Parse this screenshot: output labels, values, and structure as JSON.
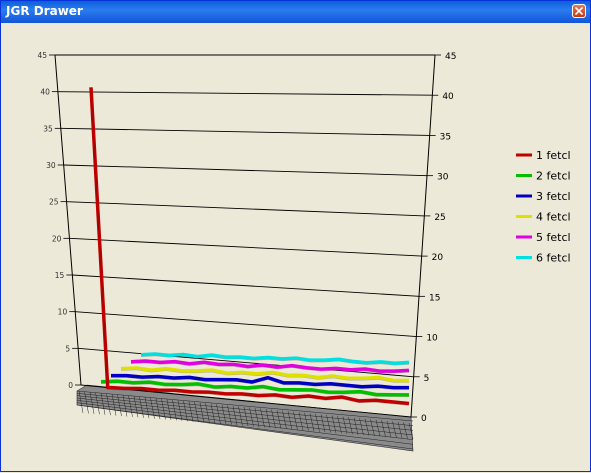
{
  "window": {
    "title": "JGR Drawer"
  },
  "chart_data": {
    "type": "line",
    "projection": "3d",
    "grid": true,
    "legend_position": "right",
    "ylim": [
      0,
      45
    ],
    "y_ticks": [
      "0",
      "5",
      "10",
      "15",
      "20",
      "25",
      "30",
      "35",
      "40",
      "45"
    ],
    "series": [
      {
        "name": "1 fetcl",
        "color": "#c00000",
        "values": [
          41,
          0.2,
          0.2,
          0.3,
          0.2,
          0.3,
          0.2,
          0.3,
          0.2,
          0.3,
          0.2,
          0.4,
          0.2,
          0.5,
          0.3,
          0.6,
          0.2,
          0.4,
          0.3,
          0.2
        ]
      },
      {
        "name": "2 fetcl",
        "color": "#00c000",
        "values": [
          0.3,
          0.5,
          0.4,
          0.6,
          0.4,
          0.5,
          0.7,
          0.4,
          0.6,
          0.5,
          0.8,
          0.5,
          0.6,
          0.7,
          0.5,
          0.6,
          0.8,
          0.5,
          0.6,
          0.7
        ]
      },
      {
        "name": "3 fetcl",
        "color": "#0000c0",
        "values": [
          0.6,
          0.7,
          0.6,
          0.8,
          0.7,
          0.9,
          0.7,
          0.8,
          0.9,
          0.7,
          1.4,
          0.8,
          0.9,
          0.8,
          1.0,
          0.9,
          0.8,
          1.0,
          0.9,
          1.0
        ]
      },
      {
        "name": "4 fetcl",
        "color": "#e0e000",
        "values": [
          1.0,
          1.2,
          1.0,
          1.3,
          1.1,
          1.2,
          1.4,
          1.1,
          1.3,
          1.2,
          1.5,
          1.2,
          1.3,
          1.1,
          1.4,
          1.2,
          1.3,
          1.5,
          1.2,
          1.3
        ]
      },
      {
        "name": "5 fetcl",
        "color": "#e000e0",
        "values": [
          1.4,
          1.6,
          1.5,
          1.7,
          1.5,
          1.8,
          1.6,
          1.7,
          1.5,
          1.8,
          1.6,
          1.9,
          1.7,
          1.6,
          1.8,
          1.7,
          1.9,
          1.7,
          1.8,
          2.0
        ]
      },
      {
        "name": "6 fetcl",
        "color": "#00e0e0",
        "values": [
          1.8,
          2.0,
          1.9,
          2.1,
          1.9,
          2.2,
          2.0,
          2.1,
          2.0,
          2.2,
          2.1,
          2.3,
          2.1,
          2.2,
          2.4,
          2.2,
          2.1,
          2.3,
          2.2,
          2.4
        ]
      }
    ]
  }
}
